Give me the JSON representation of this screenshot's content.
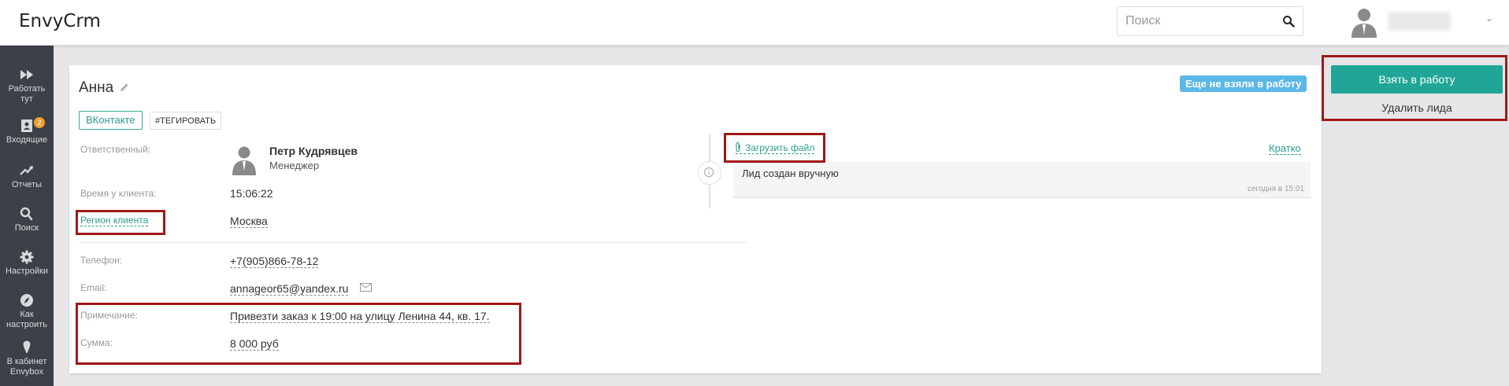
{
  "app": {
    "title": "EnvyCrm"
  },
  "search": {
    "placeholder": "Поиск"
  },
  "sidebar": {
    "items": [
      {
        "label": "Работать\nтут",
        "icon": "fast-forward-icon"
      },
      {
        "label": "Входящие",
        "icon": "inbox-icon",
        "badge": "2"
      },
      {
        "label": "Отчеты",
        "icon": "trend-up-icon"
      },
      {
        "label": "Поиск",
        "icon": "search-icon"
      },
      {
        "label": "Настройки",
        "icon": "gear-icon"
      },
      {
        "label": "Как\nнастроить",
        "icon": "compass-icon"
      },
      {
        "label": "В кабинет\nEnvybox",
        "icon": "ice-cream-icon"
      }
    ]
  },
  "lead": {
    "name": "Анна",
    "status": "Еще не взяли в работу",
    "source_button": "ВКонтакте",
    "tag_button": "#ТЕГИРОВАТЬ",
    "fields": {
      "responsible_label": "Ответственный:",
      "responsible_name": "Петр Кудрявцев",
      "responsible_role": "Менеджер",
      "client_time_label": "Время у клиента:",
      "client_time": "15:06:22",
      "region_label": "Регион клиента",
      "region": "Москва",
      "phone_label": "Телефон:",
      "phone": "+7(905)866-78-12",
      "email_label": "Email:",
      "email": "annageor65@yandex.ru",
      "note_label": "Примечание:",
      "note": "Привезти заказ к 19:00 на улицу Ленина 44, кв. 17.",
      "sum_label": "Сумма:",
      "sum": "8 000 руб"
    }
  },
  "timeline": {
    "upload_label": "Загрузить файл",
    "brief_label": "Кратко",
    "events": [
      {
        "text": "Лид создан вручную",
        "time": "сегодня в 15:01"
      }
    ]
  },
  "actions": {
    "take_label": "Взять в работу",
    "delete_label": "Удалить лида"
  },
  "colors": {
    "accent": "#20a698",
    "sidebar_bg": "#3c4147",
    "status_badge": "#5bb7e6",
    "highlight_box": "#a01818",
    "notification_badge": "#f0a030"
  }
}
